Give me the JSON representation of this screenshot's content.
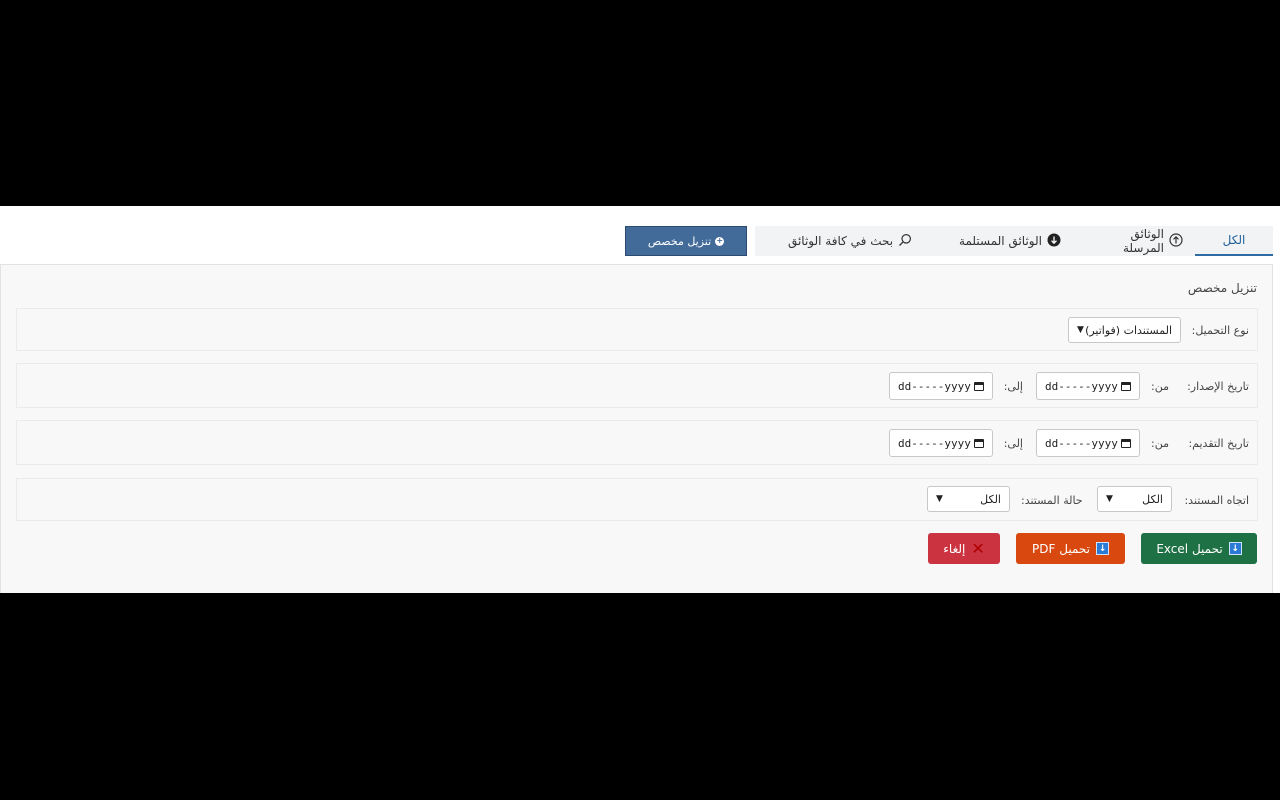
{
  "tabs": [
    {
      "label": "الكل",
      "icon": "none",
      "active": true
    },
    {
      "label": "الوثائق المرسلة",
      "icon": "upload-circle-icon"
    },
    {
      "label": "الوثائق المستلمة",
      "icon": "download-circle-icon"
    },
    {
      "label": "بحث في كافة الوثائق",
      "icon": "search-icon"
    }
  ],
  "custom_download": {
    "label": "تنزيل مخصص",
    "icon": "plus-circle-icon",
    "color": "#426b9a"
  },
  "panel": {
    "title": "تنزيل مخصص",
    "download_type": {
      "label": "نوع التحميل:",
      "value": "المستندات (فواتير)"
    },
    "issue_date": {
      "label": "تاريخ الإصدار:",
      "from_label": "من:",
      "to_label": "إلى:",
      "from_value": "dd-----yyyy",
      "to_value": "dd-----yyyy"
    },
    "submission_date": {
      "label": "تاريخ التقديم:",
      "from_label": "من:",
      "to_label": "إلى:",
      "from_value": "dd-----yyyy",
      "to_value": "dd-----yyyy"
    },
    "direction": {
      "label": "اتجاه المستند:",
      "value": "الكل"
    },
    "status": {
      "label": "حالة المستند:",
      "value": "الكل"
    }
  },
  "actions": {
    "excel": {
      "label": "تحميل Excel",
      "color": "#1e7045"
    },
    "pdf": {
      "label": "تحميل PDF",
      "color": "#d9480f"
    },
    "cancel": {
      "label": "إلغاء",
      "color": "#cc3340"
    }
  }
}
